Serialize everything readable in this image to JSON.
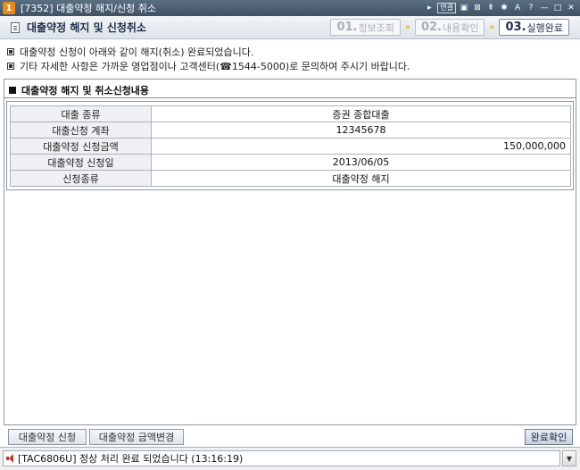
{
  "window": {
    "number": "1",
    "title": "[7352] 대출약정 해지/신청 취소",
    "controls": {
      "link_label": "연결",
      "icons": [
        "nav-arrow-icon",
        "link-icon",
        "save-icon",
        "print-icon",
        "pin-icon",
        "gear-icon",
        "font-icon",
        "help-icon",
        "minimize-icon",
        "maximize-icon",
        "close-icon"
      ],
      "glyphs": [
        "▸",
        "▣",
        "⊠",
        "⇞",
        "✱",
        "A",
        "?",
        "—",
        "□",
        "✕"
      ]
    }
  },
  "header": {
    "title": "대출약정 해지 및 신청취소",
    "steps": [
      {
        "num": "01.",
        "label": "정보조회",
        "active": false
      },
      {
        "num": "02.",
        "label": "내용확인",
        "active": false
      },
      {
        "num": "03.",
        "label": "실행완료",
        "active": true
      }
    ],
    "arrow": "»"
  },
  "messages": [
    "대출약정 신청이 아래와 같이 해지(취소) 완료되었습니다.",
    "기타 자세한 사항은 가까운 영업점이나 고객센터(☎1544-5000)로 문의하여 주시기 바랍니다."
  ],
  "section": {
    "title": "대출약정 해지 및 취소신청내용",
    "rows": [
      {
        "label": "대출 종류",
        "value": "증권 종합대출"
      },
      {
        "label": "대출신청 계좌",
        "value": "12345678"
      },
      {
        "label": "대출약정 신청금액",
        "value": "150,000,000"
      },
      {
        "label": "대출약정 신청일",
        "value": "2013/06/05"
      },
      {
        "label": "신청종류",
        "value": "대출약정 해지"
      }
    ]
  },
  "buttons": {
    "apply": "대출약정 신청",
    "change_amount": "대출약정 금액변경",
    "confirm": "완료확인"
  },
  "status": {
    "message": "[TAC6806U] 정상 처리 완료 되었습니다 (13:16:19)",
    "dropdown_glyph": "▼"
  }
}
